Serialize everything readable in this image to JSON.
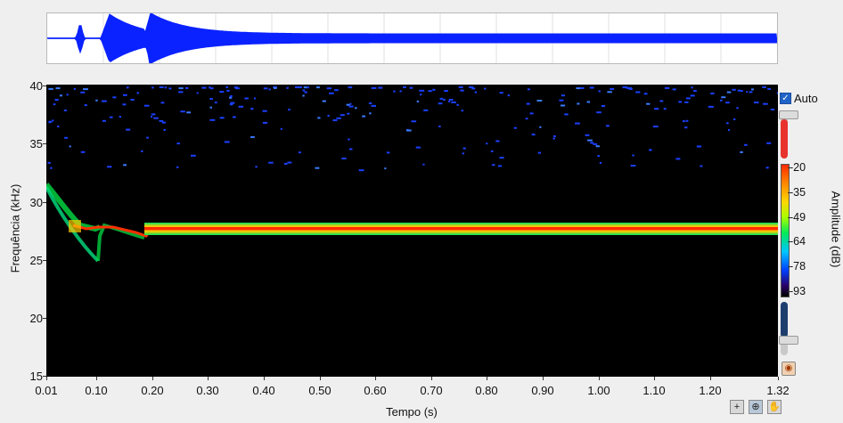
{
  "axes": {
    "ylabel": "Frequência (kHz)",
    "xlabel": "Tempo (s)",
    "yticks": [
      "40",
      "35",
      "30",
      "25",
      "20",
      "15"
    ],
    "xticks": [
      "0.01",
      "0.10",
      "0.20",
      "0.30",
      "0.40",
      "0.50",
      "0.60",
      "0.70",
      "0.80",
      "0.90",
      "1.00",
      "1.10",
      "1.20",
      "1.32"
    ]
  },
  "colorbar": {
    "title": "Amplitude (dB)",
    "ticks": [
      "-20",
      "-35",
      "-49",
      "-64",
      "-78",
      "-93"
    ],
    "auto_label": "Auto",
    "auto_checked": true
  },
  "colors": {
    "waveform": "#0a22ff",
    "spectrogram_bg": "#000000",
    "noise": "#1b40ff"
  },
  "tools": {
    "cursor_icon": "crosshair-icon",
    "zoom_icon": "zoom-icon",
    "pan_icon": "pan-hand-icon"
  }
}
